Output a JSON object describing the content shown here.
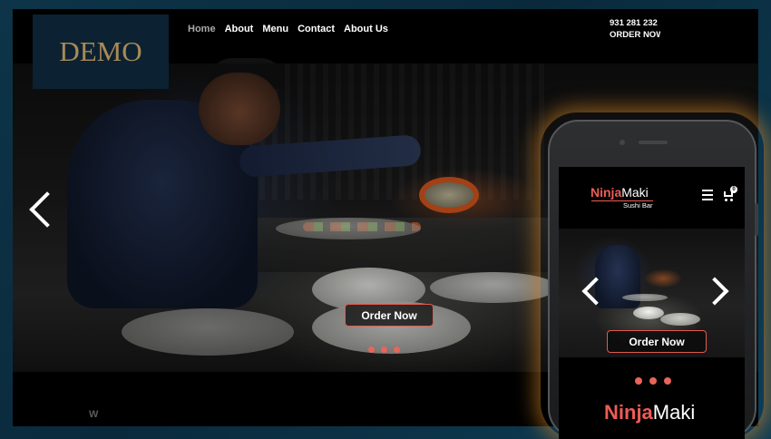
{
  "logo": {
    "text": "DEMO"
  },
  "nav": {
    "items": [
      {
        "label": "Home",
        "active": true
      },
      {
        "label": "About"
      },
      {
        "label": "Menu"
      },
      {
        "label": "Contact"
      },
      {
        "label": "About Us"
      }
    ]
  },
  "contact": {
    "phone": "931 281 232",
    "order": "ORDER NOW"
  },
  "hero": {
    "order_button": "Order Now",
    "slide_count": 3
  },
  "footer_hint": {
    "letter": "W"
  },
  "mobile": {
    "brand_ninja": "Ninja",
    "brand_maki": "Maki",
    "brand_sub": "Sushi Bar",
    "cart_count": "0",
    "order_button": "Order Now",
    "slide_count": 3,
    "title_ninja": "Ninja",
    "title_maki": "Maki"
  },
  "icons": {
    "slider_prev": "chevron-left-icon",
    "slider_next": "chevron-right-icon",
    "menu": "hamburger-icon",
    "cart": "cart-icon"
  },
  "colors": {
    "accent": "#ef5b57",
    "logo_text": "#a88a57",
    "logo_bg": "#0c2232",
    "glow": "#e08c28",
    "backdrop": "#0d3448"
  }
}
